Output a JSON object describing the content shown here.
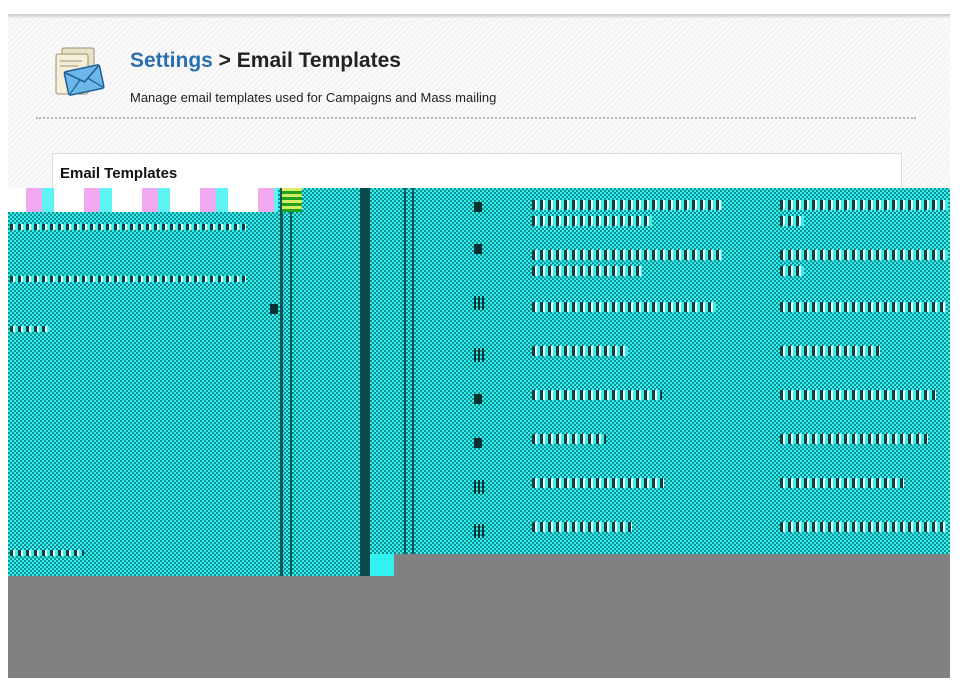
{
  "header": {
    "breadcrumb_link": "Settings",
    "breadcrumb_separator": " > ",
    "title": "Email Templates",
    "subtitle": "Manage email templates used for Campaigns and Mass mailing",
    "icon": "email-template-icon"
  },
  "panel": {
    "title": "Email Templates"
  },
  "colors": {
    "link": "#2a6fb0",
    "glitch_cyan": "#35f0f0",
    "glitch_teal": "#0f8f8f",
    "gray_fill": "#818181"
  }
}
